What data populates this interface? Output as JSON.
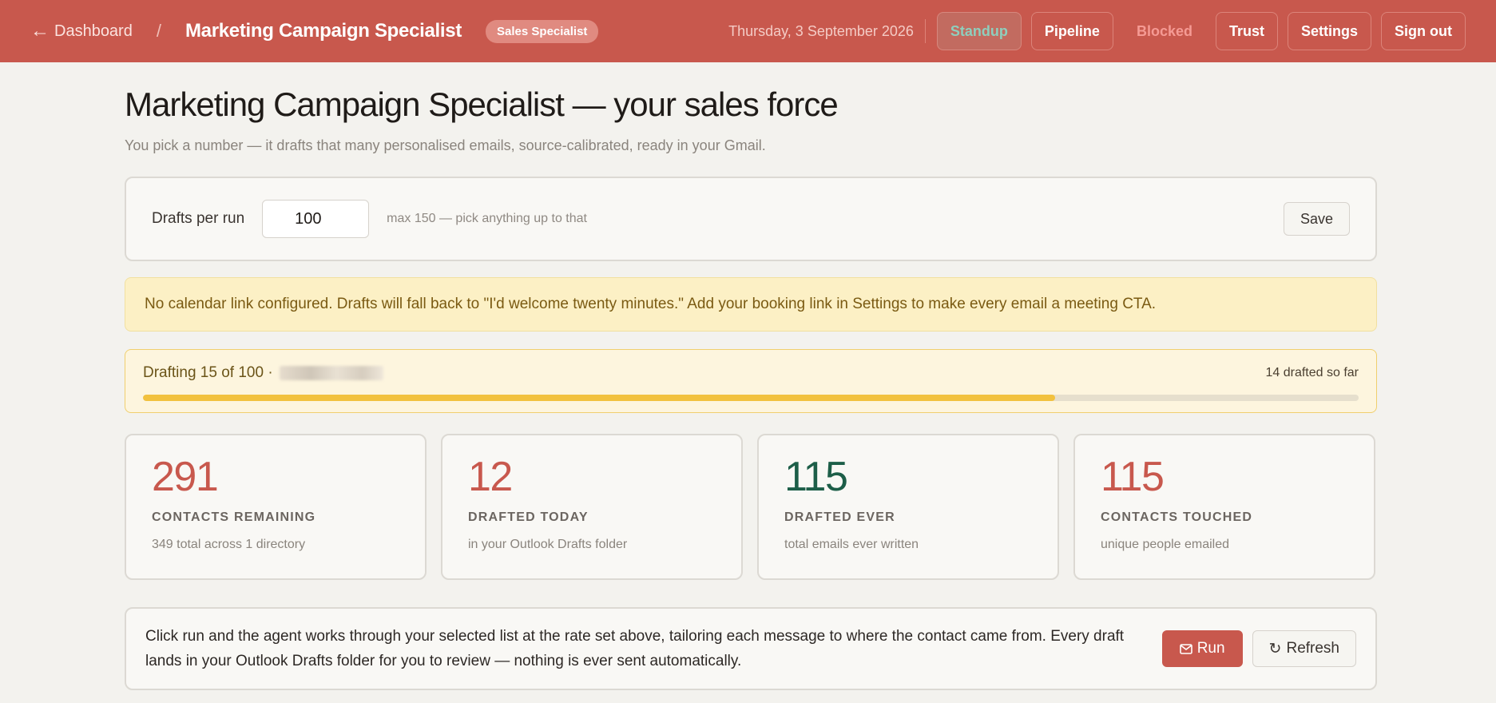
{
  "header": {
    "back_label": "Dashboard",
    "breadcrumb_sep": "/",
    "title": "Marketing Campaign Specialist",
    "role_badge": "Sales Specialist",
    "date": "Thursday, 3 September 2026",
    "nav": {
      "standup": "Standup",
      "pipeline": "Pipeline",
      "blocked": "Blocked",
      "trust": "Trust",
      "settings": "Settings",
      "sign_out": "Sign out"
    },
    "active_nav": "Standup"
  },
  "page": {
    "title": "Marketing Campaign Specialist — your sales force",
    "subtitle": "You pick a number — it drafts that many personalised emails, source-calibrated, ready in your Gmail."
  },
  "settings": {
    "label": "Drafts per run",
    "value": "100",
    "hint": "max 150 — pick anything up to that",
    "save_label": "Save"
  },
  "alert": {
    "text": "No calendar link configured. Drafts will fall back to \"I'd welcome twenty minutes.\" Add your booking link in Settings to make every email a meeting CTA."
  },
  "progress": {
    "status": "Drafting 15 of 100 ·",
    "count_label": "14 drafted so far",
    "fraction": 0.75
  },
  "stats": [
    {
      "value": "291",
      "label": "Contacts remaining",
      "note": "349 total across 1 directory",
      "color": "#c8584d"
    },
    {
      "value": "12",
      "label": "Drafted today",
      "note": "in your Outlook Drafts folder",
      "color": "#c8584d"
    },
    {
      "value": "115",
      "label": "Drafted ever",
      "note": "total emails ever written",
      "color": "#1d5e48"
    },
    {
      "value": "115",
      "label": "Contacts touched",
      "note": "unique people emailed",
      "color": "#c8584d"
    }
  ],
  "run": {
    "text": "Click run and the agent works through your selected list at the rate set above, tailoring each message to where the contact came from. Every draft lands in your Outlook Drafts folder for you to review — nothing is ever sent automatically.",
    "run_label": "Run",
    "refresh_label": "Refresh"
  },
  "colors": {
    "brand": "#c8584d",
    "accent_green": "#1d5e48",
    "progress": "#f2c13e"
  }
}
